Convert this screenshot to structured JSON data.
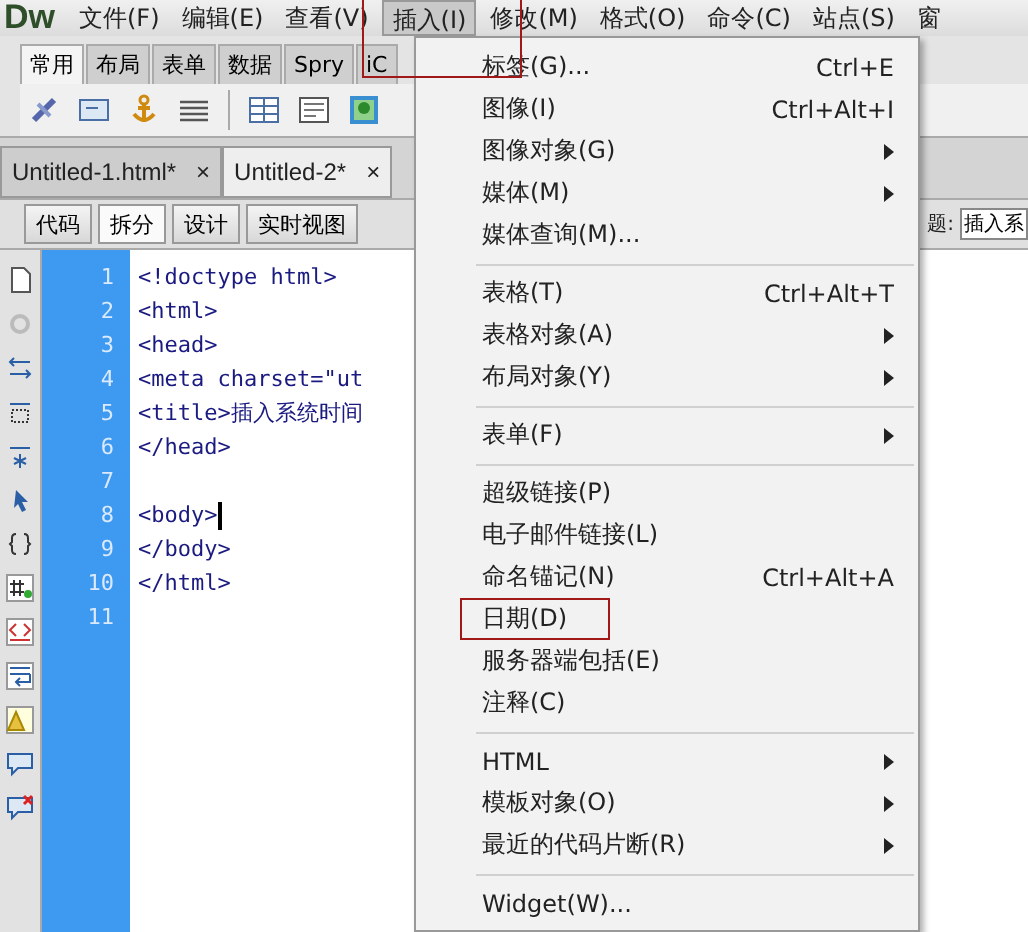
{
  "app_logo": "Dw",
  "menu_bar": [
    {
      "label": "文件(F)",
      "selected": false,
      "annotated": false
    },
    {
      "label": "编辑(E)",
      "selected": false,
      "annotated": false
    },
    {
      "label": "查看(V)",
      "selected": false,
      "annotated": false
    },
    {
      "label": "插入(I)",
      "selected": true,
      "annotated": true
    },
    {
      "label": "修改(M)",
      "selected": false,
      "annotated": false
    },
    {
      "label": "格式(O)",
      "selected": false,
      "annotated": false
    },
    {
      "label": "命令(C)",
      "selected": false,
      "annotated": false
    },
    {
      "label": "站点(S)",
      "selected": false,
      "annotated": false
    },
    {
      "label": "窗",
      "selected": false,
      "annotated": false
    }
  ],
  "insert_panel": {
    "tabs": [
      {
        "label": "常用",
        "selected": true
      },
      {
        "label": "布局",
        "selected": false
      },
      {
        "label": "表单",
        "selected": false
      },
      {
        "label": "数据",
        "selected": false
      },
      {
        "label": "Spry",
        "selected": false
      },
      {
        "label": "iC",
        "selected": false
      }
    ]
  },
  "document_tabs": [
    {
      "label": "Untitled-1.html*",
      "close": "×",
      "selected": false
    },
    {
      "label": "Untitled-2*",
      "close": "×",
      "selected": true
    }
  ],
  "view_buttons": [
    {
      "label": "代码",
      "selected": false
    },
    {
      "label": "拆分",
      "selected": true
    },
    {
      "label": "设计",
      "selected": false
    },
    {
      "label": "实时视图",
      "selected": false
    }
  ],
  "title_field": {
    "label": "题:",
    "value": "插入系"
  },
  "code_lines": [
    {
      "number": "1",
      "text": "<!doctype html>",
      "cursor": false
    },
    {
      "number": "2",
      "text": "<html>",
      "cursor": false
    },
    {
      "number": "3",
      "text": "<head>",
      "cursor": false
    },
    {
      "number": "4",
      "text": "<meta charset=\"ut",
      "cursor": false
    },
    {
      "number": "5",
      "text": "<title>插入系统时间",
      "cursor": false
    },
    {
      "number": "6",
      "text": "</head>",
      "cursor": false
    },
    {
      "number": "7",
      "cursor": false
    },
    {
      "number": "8",
      "text": "<body>",
      "cursor": true
    },
    {
      "number": "9",
      "text": "</body>",
      "cursor": false
    },
    {
      "number": "10",
      "text": "</html>",
      "cursor": false
    },
    {
      "number": "11",
      "cursor": false
    }
  ],
  "dropdown_menu": [
    {
      "kind": "item",
      "label": "标签(G)...",
      "shortcut": "Ctrl+E",
      "submenu": false,
      "annotated": false
    },
    {
      "kind": "item",
      "label": "图像(I)",
      "shortcut": "Ctrl+Alt+I",
      "submenu": false,
      "annotated": false
    },
    {
      "kind": "item",
      "label": "图像对象(G)",
      "submenu": true,
      "annotated": false
    },
    {
      "kind": "item",
      "label": "媒体(M)",
      "submenu": true,
      "annotated": false
    },
    {
      "kind": "item",
      "label": "媒体查询(M)...",
      "submenu": false,
      "annotated": false
    },
    {
      "kind": "separator"
    },
    {
      "kind": "item",
      "label": "表格(T)",
      "shortcut": "Ctrl+Alt+T",
      "submenu": false,
      "annotated": false
    },
    {
      "kind": "item",
      "label": "表格对象(A)",
      "submenu": true,
      "annotated": false
    },
    {
      "kind": "item",
      "label": "布局对象(Y)",
      "submenu": true,
      "annotated": false
    },
    {
      "kind": "separator"
    },
    {
      "kind": "item",
      "label": "表单(F)",
      "submenu": true,
      "annotated": false
    },
    {
      "kind": "separator"
    },
    {
      "kind": "item",
      "label": "超级链接(P)",
      "submenu": false,
      "annotated": false
    },
    {
      "kind": "item",
      "label": "电子邮件链接(L)",
      "submenu": false,
      "annotated": false
    },
    {
      "kind": "item",
      "label": "命名锚记(N)",
      "shortcut": "Ctrl+Alt+A",
      "submenu": false,
      "annotated": false
    },
    {
      "kind": "item",
      "label": "日期(D)",
      "submenu": false,
      "annotated": true
    },
    {
      "kind": "item",
      "label": "服务器端包括(E)",
      "submenu": false,
      "annotated": false
    },
    {
      "kind": "item",
      "label": "注释(C)",
      "submenu": false,
      "annotated": false
    },
    {
      "kind": "separator"
    },
    {
      "kind": "item",
      "label": "HTML",
      "submenu": true,
      "annotated": false
    },
    {
      "kind": "item",
      "label": "模板对象(O)",
      "submenu": true,
      "annotated": false
    },
    {
      "kind": "item",
      "label": "最近的代码片断(R)",
      "submenu": true,
      "annotated": false
    },
    {
      "kind": "separator"
    },
    {
      "kind": "item",
      "label": "Widget(W)...",
      "submenu": false,
      "annotated": false
    }
  ]
}
